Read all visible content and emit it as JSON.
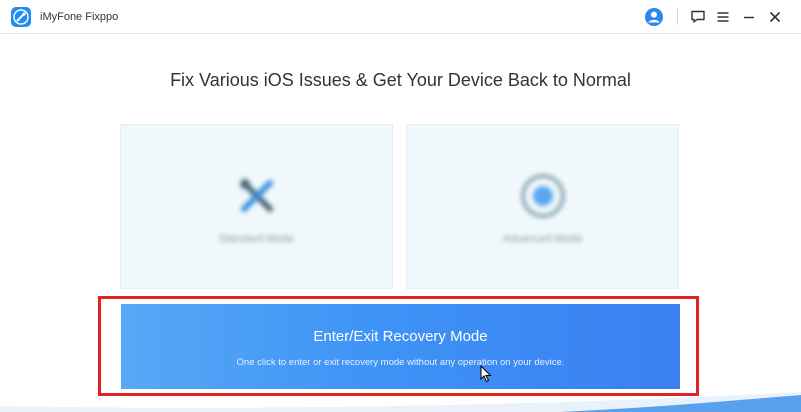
{
  "window": {
    "app_title": "iMyFone Fixppo",
    "icons": {
      "logo": "wrench-app-icon",
      "user": "user-account-icon",
      "feedback": "feedback-chat-icon",
      "menu": "hamburger-menu-icon",
      "minimize": "minimize-icon",
      "close": "close-icon"
    }
  },
  "main": {
    "headline": "Fix Various iOS Issues & Get Your Device Back to Normal",
    "modes": [
      {
        "label": "Standard Mode",
        "icon": "tools-icon"
      },
      {
        "label": "Advanced Mode",
        "icon": "gear-circle-icon"
      }
    ],
    "recovery": {
      "title": "Enter/Exit Recovery Mode",
      "subtitle": "One click to enter or exit recovery mode without any operation on your device."
    }
  },
  "colors": {
    "accent": "#3e93f6",
    "highlight": "#e02424",
    "card_bg": "#f0f8fb"
  }
}
